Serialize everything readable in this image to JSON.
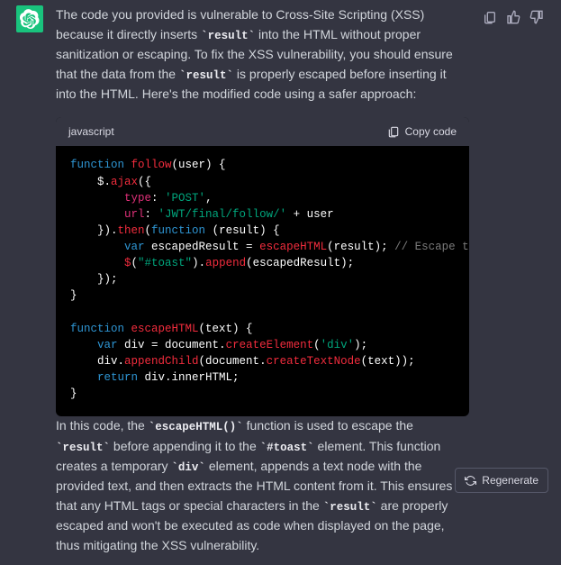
{
  "avatar": {
    "bg": "#19c37d"
  },
  "actions": {
    "copy_tooltip": "Copy",
    "like_tooltip": "Like",
    "dislike_tooltip": "Dislike"
  },
  "explanation": {
    "p1_a": "The code you provided is vulnerable to Cross-Site Scripting (XSS) because it directly inserts ",
    "p1_code1": "result",
    "p1_b": " into the HTML without proper sanitization or escaping. To fix the XSS vulnerability, you should ensure that the data from the ",
    "p1_code2": "result",
    "p1_c": " is properly escaped before inserting it into the HTML. Here's the modified code using a safer approach:"
  },
  "codeblock": {
    "lang": "javascript",
    "copy_label": "Copy code",
    "code": {
      "l1_kw": "function",
      "l1_fn": "follow",
      "l1_rest": "(user) {",
      "l2_a": "    $.",
      "l2_fn": "ajax",
      "l2_b": "({",
      "l3_a": "        ",
      "l3_key": "type",
      "l3_b": ": ",
      "l3_str": "'POST'",
      "l3_c": ",",
      "l4_a": "        ",
      "l4_key": "url",
      "l4_b": ": ",
      "l4_str": "'JWT/final/follow/'",
      "l4_c": " + user",
      "l5_a": "    }).",
      "l5_fn": "then",
      "l5_b": "(",
      "l5_kw": "function",
      "l5_c": " (result) {",
      "l6_a": "        ",
      "l6_kw": "var",
      "l6_b": " escapedResult = ",
      "l6_fn": "escapeHTML",
      "l6_c": "(result); ",
      "l6_com": "// Escape the result",
      "l7_a": "        ",
      "l7_fn1": "$",
      "l7_b": "(",
      "l7_str": "\"#toast\"",
      "l7_c": ").",
      "l7_fn2": "append",
      "l7_d": "(escapedResult);",
      "l8": "    });",
      "l9": "}",
      "l10": "",
      "l11_kw": "function",
      "l11_fn": "escapeHTML",
      "l11_rest": "(text) {",
      "l12_a": "    ",
      "l12_kw": "var",
      "l12_b": " div = ",
      "l12_obj": "document",
      "l12_c": ".",
      "l12_fn": "createElement",
      "l12_d": "(",
      "l12_str": "'div'",
      "l12_e": ");",
      "l13_a": "    div.",
      "l13_fn1": "appendChild",
      "l13_b": "(",
      "l13_obj": "document",
      "l13_c": ".",
      "l13_fn2": "createTextNode",
      "l13_d": "(text));",
      "l14_a": "    ",
      "l14_kw": "return",
      "l14_b": " div.innerHTML;",
      "l15": "}"
    }
  },
  "explanation2": {
    "p2_a": "In this code, the ",
    "p2_code1": "escapeHTML()",
    "p2_b": " function is used to escape the ",
    "p2_code2": "result",
    "p2_c": " before appending it to the ",
    "p2_code3": "#toast",
    "p2_d": " element. This function creates a temporary ",
    "p2_code4": "div",
    "p2_e": " element, appends a text node with the provided text, and then extracts the HTML content from it. This ensures that any HTML tags or special characters in the ",
    "p2_code5": "result",
    "p2_f": " are properly escaped and won't be executed as code when displayed on the page, thus mitigating the XSS vulnerability."
  },
  "regenerate_label": "Regenerate"
}
